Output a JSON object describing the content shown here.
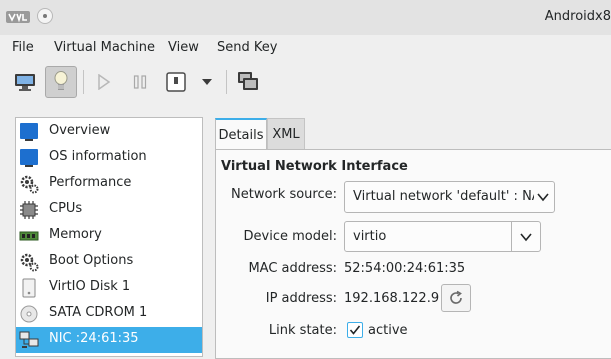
{
  "window": {
    "title": "Androidx8"
  },
  "menubar": [
    "File",
    "Virtual Machine",
    "View",
    "Send Key"
  ],
  "toolbar": {
    "items": [
      "monitor-icon",
      "lightbulb-icon",
      "play-icon",
      "pause-icon",
      "power-icon",
      "dropdown-arrow-icon",
      "screenshot-icon"
    ]
  },
  "devices": [
    {
      "label": "Overview",
      "icon": "monitor-icon"
    },
    {
      "label": "OS information",
      "icon": "monitor-icon"
    },
    {
      "label": "Performance",
      "icon": "gear-icon"
    },
    {
      "label": "CPUs",
      "icon": "cpu-icon"
    },
    {
      "label": "Memory",
      "icon": "memory-icon"
    },
    {
      "label": "Boot Options",
      "icon": "gear-icon"
    },
    {
      "label": "VirtIO Disk 1",
      "icon": "disk-icon"
    },
    {
      "label": "SATA CDROM 1",
      "icon": "cdrom-icon"
    },
    {
      "label": "NIC :24:61:35",
      "icon": "network-icon",
      "selected": true
    }
  ],
  "tabs": [
    "Details",
    "XML"
  ],
  "details": {
    "section_title": "Virtual Network Interface",
    "network_source_label": "Network source:",
    "network_source_value": "Virtual network 'default' : NAT",
    "device_model_label": "Device model:",
    "device_model_value": "virtio",
    "mac_label": "MAC address:",
    "mac_value": "52:54:00:24:61:35",
    "ip_label": "IP address:",
    "ip_value": "192.168.122.9",
    "link_state_label": "Link state:",
    "link_state_value": "active",
    "link_state_checked": true
  },
  "colors": {
    "selection": "#3daee9",
    "icon_blue": "#1d6fcf"
  }
}
